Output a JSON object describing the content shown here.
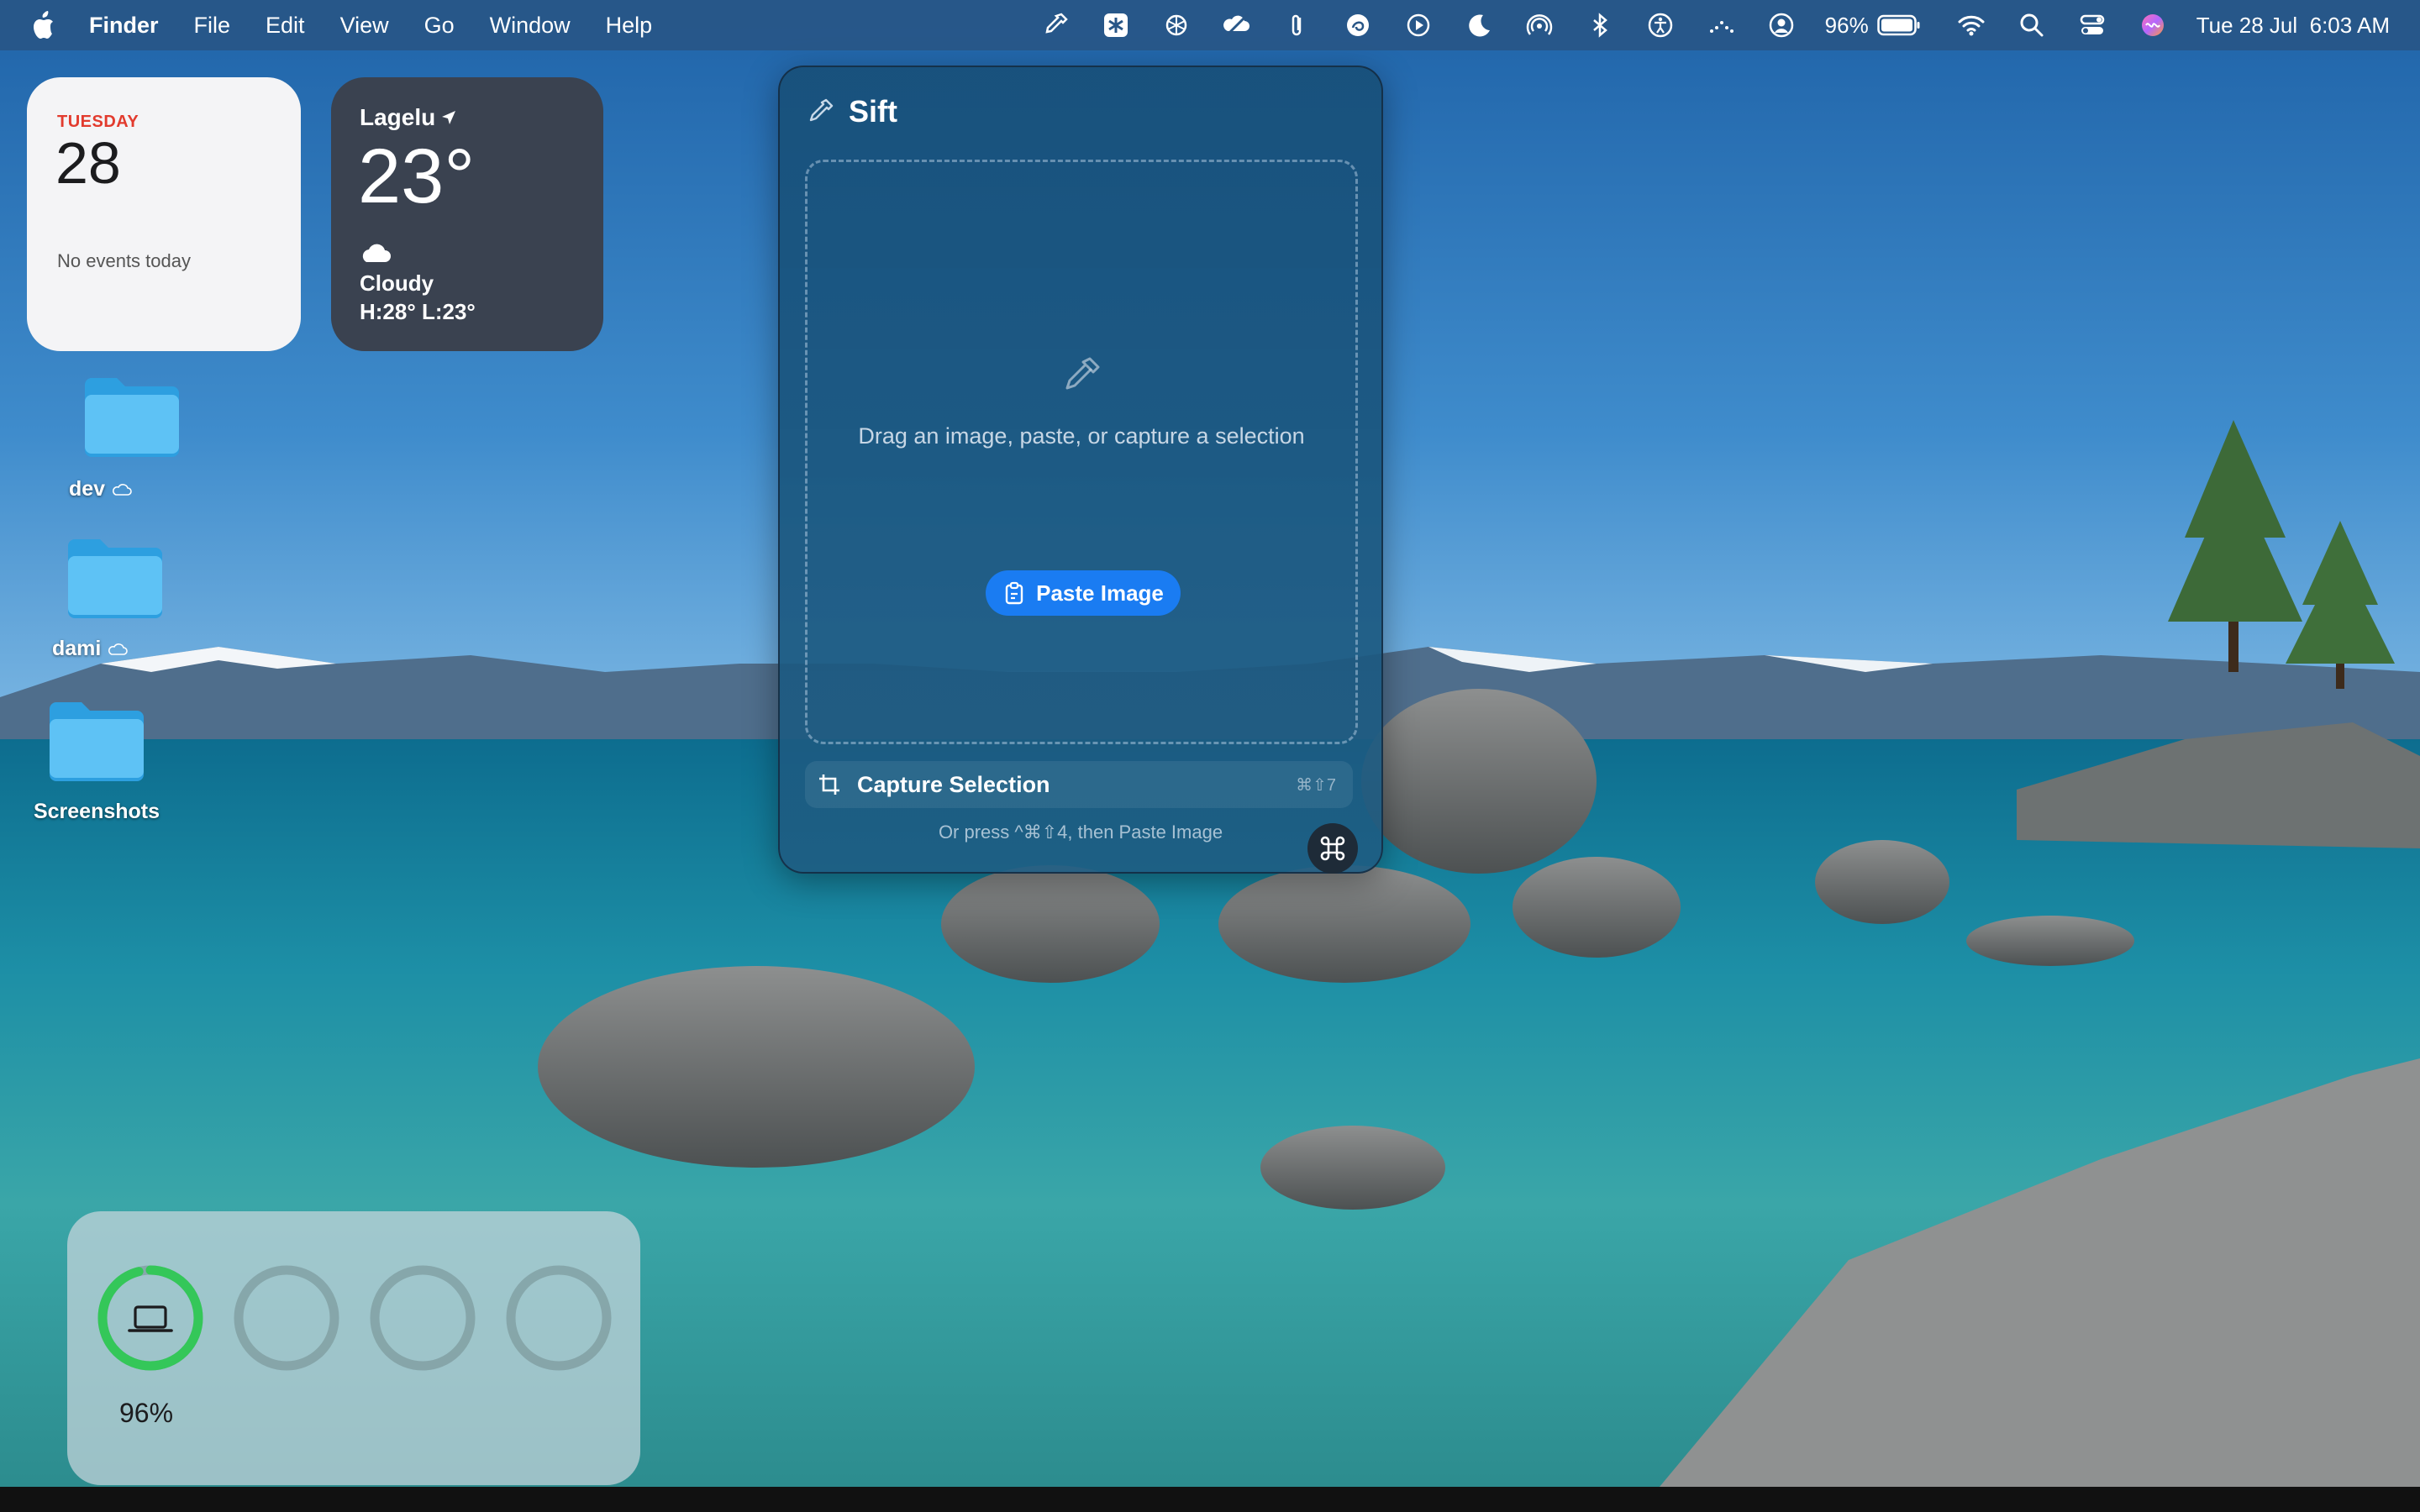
{
  "menubar": {
    "app_name": "Finder",
    "items": [
      "File",
      "Edit",
      "View",
      "Go",
      "Window",
      "Help"
    ],
    "status_icons": [
      "eyedropper-icon",
      "asterisk-app-icon",
      "openai-icon",
      "cloud-sync-icon",
      "paperclip-icon",
      "swirl-app-icon",
      "play-circle-icon",
      "moon-icon",
      "airdrop-icon",
      "bluetooth-icon",
      "accessibility-icon",
      "dots-wave-icon",
      "user-circle-icon"
    ],
    "battery_percent": "96%",
    "datetime": "Tue 28 Jul  6:03 AM"
  },
  "calendar_widget": {
    "day": "TUESDAY",
    "date": "28",
    "events": "No events today",
    "accent": "#e23b2e"
  },
  "weather_widget": {
    "location": "Lagelu",
    "temperature": "23°",
    "condition": "Cloudy",
    "high_low": "H:28° L:23°"
  },
  "desktop_folders": [
    {
      "label": "dev",
      "icloud": true
    },
    {
      "label": "dami",
      "icloud": true
    },
    {
      "label": "Screenshots",
      "icloud": false
    }
  ],
  "sift": {
    "title": "Sift",
    "drop_text": "Drag an image, paste, or capture a selection",
    "paste_button_label": "Paste Image",
    "capture_label": "Capture Selection",
    "capture_shortcut": "⌘⇧7",
    "capture_hint": "Or press ^⌘⇧4, then Paste Image",
    "accent": "#1a7cf2"
  },
  "battery_widget": {
    "device_percent": "96%",
    "device_level": 0.96,
    "ring_color": "#34c759"
  }
}
